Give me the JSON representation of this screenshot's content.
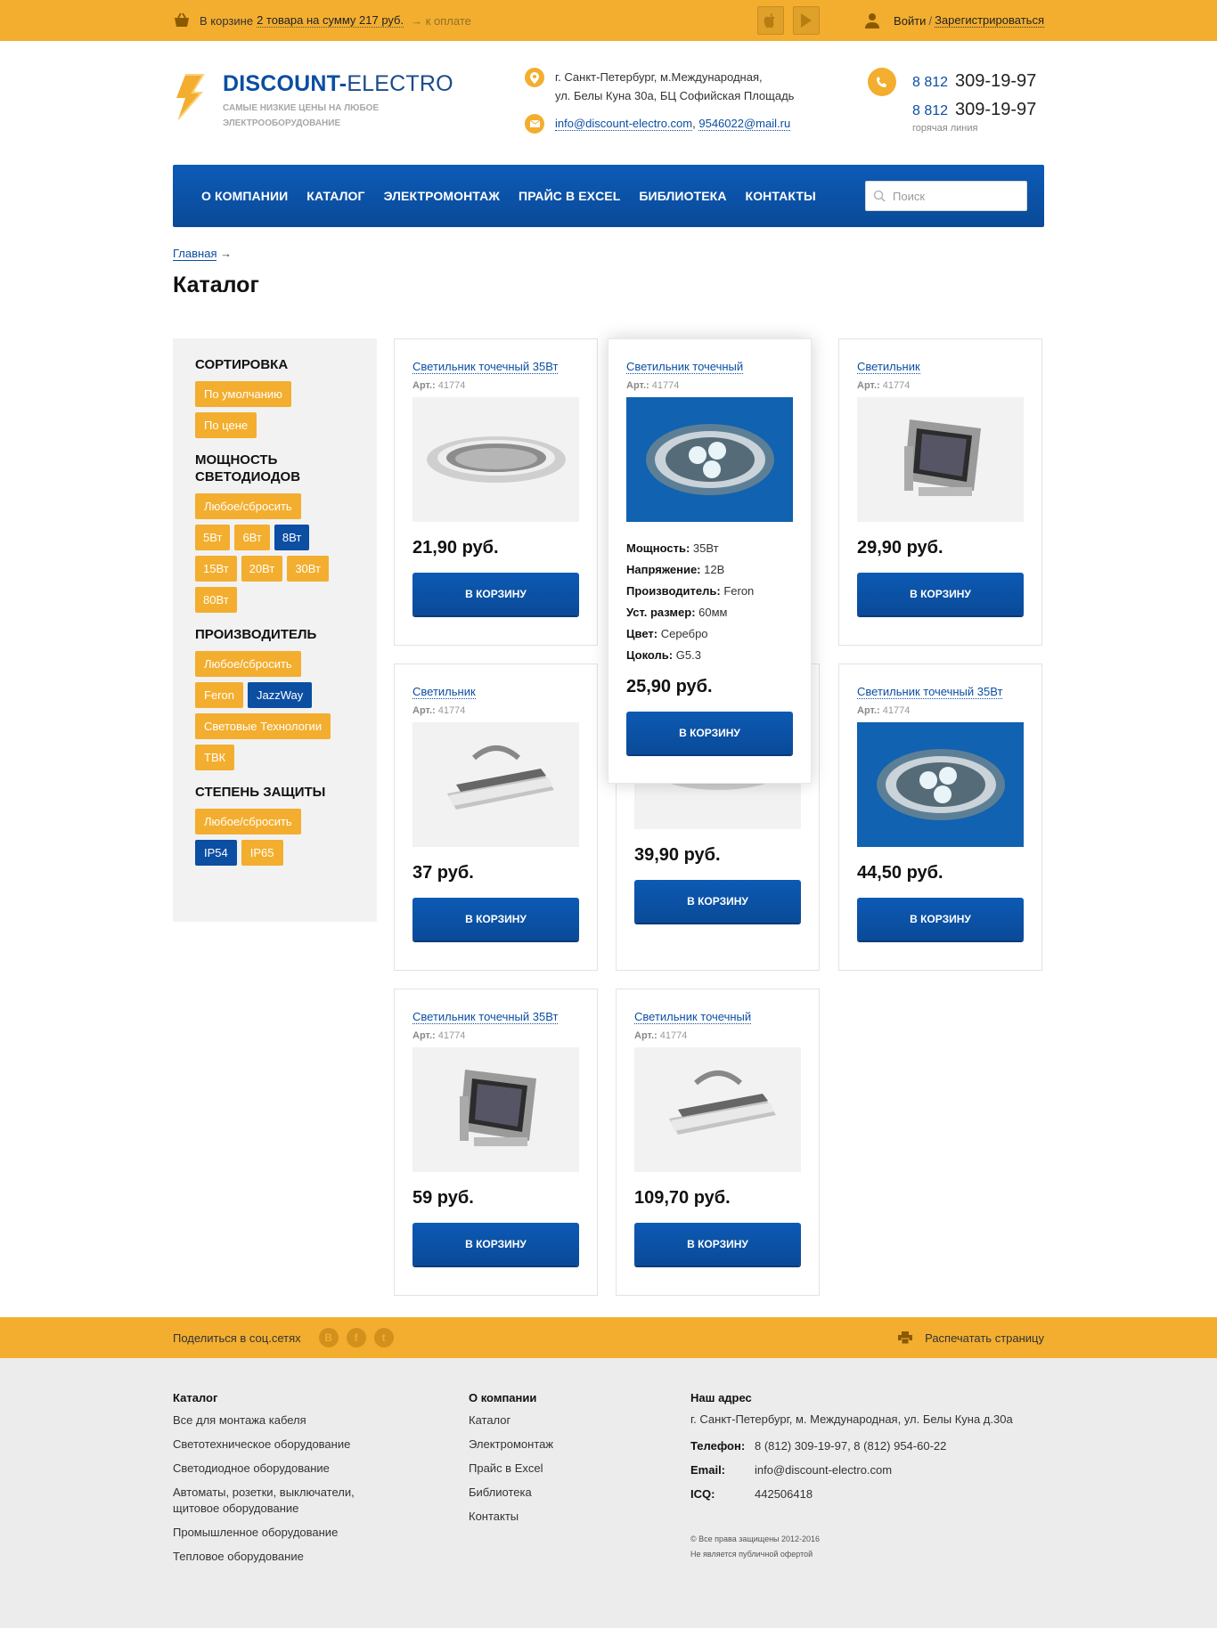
{
  "topbar": {
    "cart_prefix": "В корзине",
    "cart_amount": "2 товара на сумму 217 руб.",
    "checkout": "→ к оплате",
    "login": "Войти",
    "separator": "/",
    "register": "Зарегистрироваться",
    "icons": [
      "basket-icon",
      "apple-store-icon",
      "google-play-icon",
      "user-icon"
    ]
  },
  "header": {
    "brand_bold": "DISCOUNT-",
    "brand_light": "ELECTRO",
    "slogan": "Самые низкие цены на любое электрооборудование",
    "address_line1": "г. Санкт-Петербург, м.Международная,",
    "address_line2": "ул. Белы Куна 30а, БЦ Софийская Площадь",
    "email1": "info@discount-electro.com",
    "email_sep": ",",
    "email2": "9546022@mail.ru",
    "phone1_code": "8 812",
    "phone1_num": "309-19-97",
    "phone2_code": "8 812",
    "phone2_num": "309-19-97",
    "hotline": "горячая линия"
  },
  "nav": {
    "items": [
      "О компании",
      "Каталог",
      "Электромонтаж",
      "Прайс в Excel",
      "Библиотека",
      "Контакты"
    ],
    "search_placeholder": "Поиск"
  },
  "breadcrumb": {
    "home": "Главная",
    "arrow": "→"
  },
  "page_title": "Каталог",
  "sidebar": {
    "sort_title": "СОРТИРОВКА",
    "sort": [
      "По умолчанию",
      "По цене"
    ],
    "power_title": "МОЩНОСТЬ СВЕТОДИОДОВ",
    "power": [
      "Любое/сбросить",
      "5Вт",
      "6Вт",
      "8Вт",
      "15Вт",
      "20Вт",
      "30Вт",
      "80Вт"
    ],
    "power_active": "8Вт",
    "maker_title": "ПРОИЗВОДИТЕЛЬ",
    "maker": [
      "Любое/сбросить",
      "Feron",
      "JazzWay",
      "Световые Технологии",
      "ТВК"
    ],
    "maker_active": "JazzWay",
    "protect_title": "СТЕПЕНЬ ЗАЩИТЫ",
    "protect": [
      "Любое/сбросить",
      "IP54",
      "IP65"
    ],
    "protect_active": "IP54"
  },
  "products": [
    {
      "title": "Светильник точечный 35Вт",
      "art_label": "Арт.:",
      "art": "41774",
      "price": "21,90 руб.",
      "button": "В корзину",
      "image": "downlight-ring"
    },
    {
      "title": "Светильник точечный",
      "art_label": "Арт.:",
      "art": "41774",
      "price": "25,90 руб.",
      "button": "В корзину",
      "image": "led-spot-blue",
      "specs": [
        {
          "k": "Мощность:",
          "v": "35Вт"
        },
        {
          "k": "Напряжение:",
          "v": "12В"
        },
        {
          "k": "Производитель:",
          "v": "Feron"
        },
        {
          "k": "Уст. размер:",
          "v": "60мм"
        },
        {
          "k": "Цвет:",
          "v": "Серебро"
        },
        {
          "k": "Цоколь:",
          "v": "G5.3"
        }
      ]
    },
    {
      "title": "Светильник",
      "art_label": "Арт.:",
      "art": "41774",
      "price": "29,90 руб.",
      "button": "В корзину",
      "image": "floodlight"
    },
    {
      "title": "Светильник",
      "art_label": "Арт.:",
      "art": "41774",
      "price": "37 руб.",
      "button": "В корзину",
      "image": "industrial-lamp"
    },
    {
      "title": "",
      "art_label": "",
      "art": "",
      "price": "39,90 руб.",
      "button": "В корзину",
      "image": "downlight-ring"
    },
    {
      "title": "Светильник точечный 35Вт",
      "art_label": "Арт.:",
      "art": "41774",
      "price": "44,50 руб.",
      "button": "В корзину",
      "image": "led-spot-blue"
    },
    {
      "title": "Светильник точечный 35Вт",
      "art_label": "Арт.:",
      "art": "41774",
      "price": "59 руб.",
      "button": "В корзину",
      "image": "floodlight"
    },
    {
      "title": "Светильник точечный",
      "art_label": "Арт.:",
      "art": "41774",
      "price": "109,70 руб.",
      "button": "В корзину",
      "image": "industrial-lamp"
    }
  ],
  "share": {
    "label": "Поделиться в соц.сетях",
    "networks": [
      "В",
      "f",
      "t"
    ],
    "print": "Распечатать страницу"
  },
  "footer": {
    "catalog_title": "Каталог",
    "catalog_links": [
      "Все для монтажа кабеля",
      "Светотехническое оборудование",
      "Светодиодное оборудование",
      "Автоматы, розетки, выключатели, щитовое оборудование",
      "Промышленное оборудование",
      "Тепловое оборудование"
    ],
    "company_title": "О компании",
    "company_links": [
      "Каталог",
      "Электромонтаж",
      "Прайс в Excel",
      "Библиотека",
      "Контакты"
    ],
    "address_title": "Наш адрес",
    "address": "г. Санкт-Петербург, м. Международная, ул. Белы Куна д.30а",
    "phone_label": "Телефон:",
    "phone": "8 (812) 309-19-97, 8 (812) 954-60-22",
    "email_label": "Email:",
    "email": "info@discount-electro.com",
    "icq_label": "ICQ:",
    "icq": "442506418",
    "copyright": "© Все права защищены 2012-2016",
    "offer": "Не является публичной офертой"
  },
  "colors": {
    "accent": "#f3ae2f",
    "brand": "#0b4ea2"
  }
}
